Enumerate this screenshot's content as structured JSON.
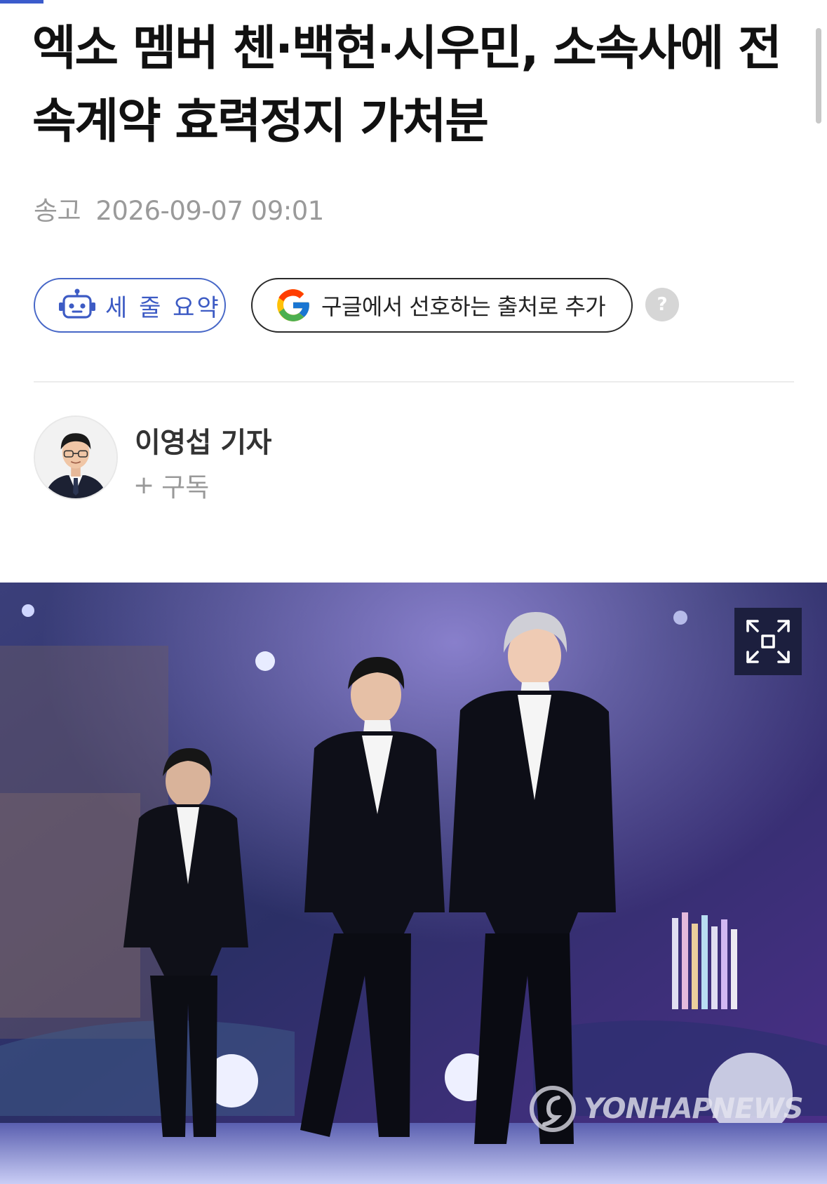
{
  "article": {
    "title": "엑소 멤버 첸·백현·시우민, 소속사에 전속계약 효력정지 가처분",
    "dateline_label": "송고",
    "dateline_value": "2026-09-07 09:01"
  },
  "actions": {
    "summary_label": "세 줄 요약",
    "google_label": "구글에서 선호하는 출처로 추가",
    "help_glyph": "?"
  },
  "author": {
    "name": "이영섭 기자",
    "subscribe_plus": "+",
    "subscribe_label": "구독"
  },
  "photo": {
    "watermark": "YONHAPNEWS"
  },
  "colors": {
    "accent": "#3d5bc4",
    "title": "#111111",
    "meta": "#9a9a9a"
  },
  "icons": {
    "summary": "robot-icon",
    "google": "google-icon",
    "help": "question-icon",
    "expand": "expand-icon"
  }
}
